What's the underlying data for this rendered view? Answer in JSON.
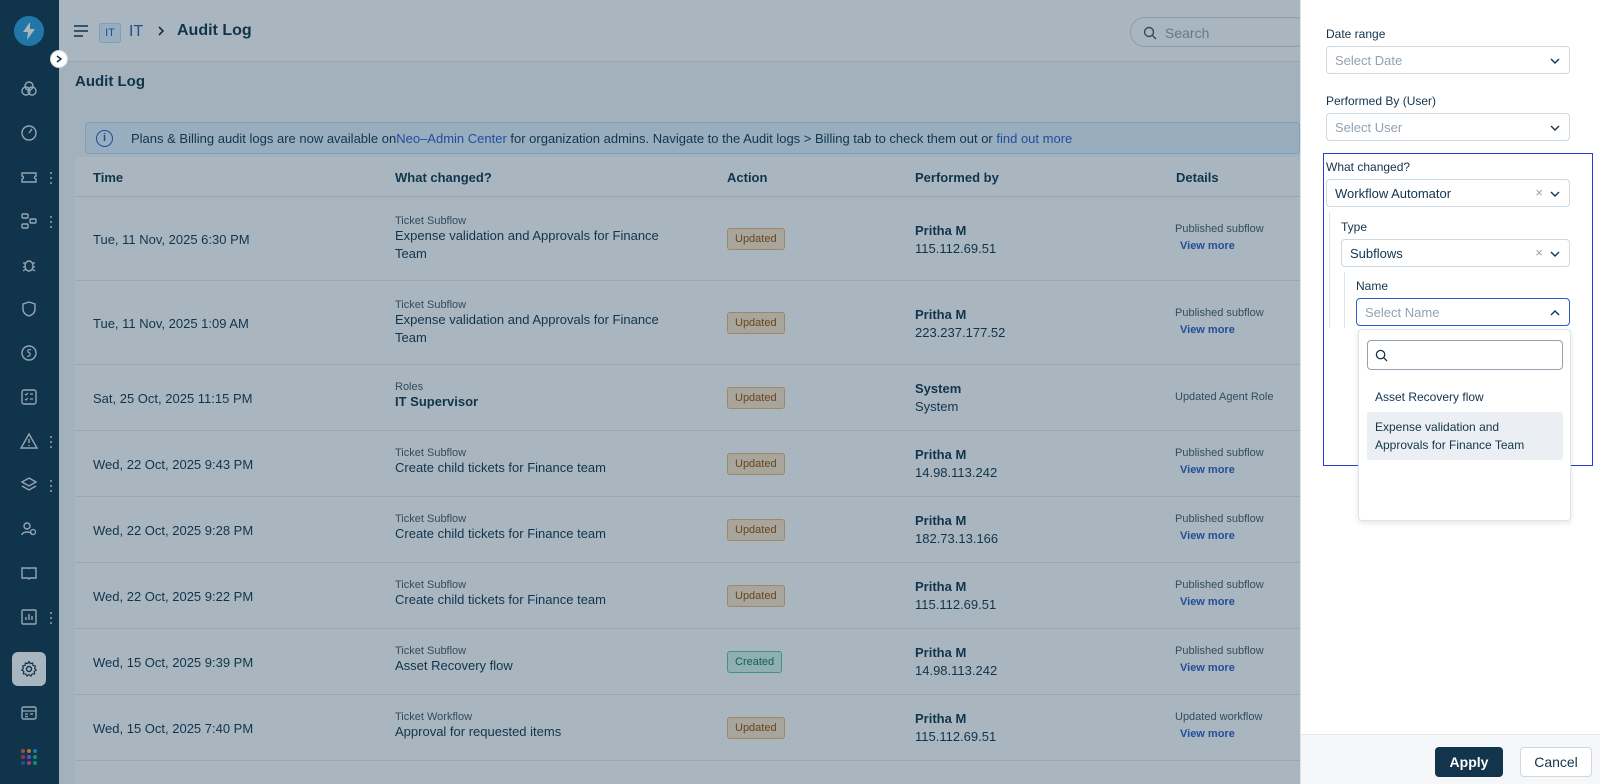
{
  "header": {
    "workspace_badge": "IT",
    "workspace_name": "IT",
    "title": "Audit Log",
    "search_placeholder": "Search"
  },
  "main": {
    "page_title": "Audit Log",
    "banner": {
      "text1": "Plans & Billing audit logs are now available on ",
      "link1": "Neo–Admin Center",
      "text2": " for organization admins. Navigate to the Audit logs > Billing tab to check them out or ",
      "link2": "find out more"
    },
    "columns": [
      "Time",
      "What changed?",
      "Action",
      "Performed by",
      "Details"
    ],
    "rows": [
      {
        "time": "Tue, 11 Nov, 2025 6:30 PM",
        "category": "Ticket Subflow",
        "name": "Expense validation and Approvals for Finance Team",
        "action": "Updated",
        "user": "Pritha M",
        "ip": "115.112.69.51",
        "details": "Published subflow",
        "link": "View more"
      },
      {
        "time": "Tue, 11 Nov, 2025 1:09 AM",
        "category": "Ticket Subflow",
        "name": "Expense validation and Approvals for Finance Team",
        "action": "Updated",
        "user": "Pritha M",
        "ip": "223.237.177.52",
        "details": "Published subflow",
        "link": "View more"
      },
      {
        "time": "Sat, 25 Oct, 2025 11:15 PM",
        "category": "Roles",
        "name": "IT Supervisor",
        "action": "Updated",
        "user": "System",
        "ip": "System",
        "details": "Updated Agent Role",
        "link": ""
      },
      {
        "time": "Wed, 22 Oct, 2025 9:43 PM",
        "category": "Ticket Subflow",
        "name": "Create child tickets for Finance team",
        "action": "Updated",
        "user": "Pritha M",
        "ip": "14.98.113.242",
        "details": "Published subflow",
        "link": "View more"
      },
      {
        "time": "Wed, 22 Oct, 2025 9:28 PM",
        "category": "Ticket Subflow",
        "name": "Create child tickets for Finance team",
        "action": "Updated",
        "user": "Pritha M",
        "ip": "182.73.13.166",
        "details": "Published subflow",
        "link": "View more"
      },
      {
        "time": "Wed, 22 Oct, 2025 9:22 PM",
        "category": "Ticket Subflow",
        "name": "Create child tickets for Finance team",
        "action": "Updated",
        "user": "Pritha M",
        "ip": "115.112.69.51",
        "details": "Published subflow",
        "link": "View more"
      },
      {
        "time": "Wed, 15 Oct, 2025 9:39 PM",
        "category": "Ticket Subflow",
        "name": "Asset Recovery flow",
        "action": "Created",
        "user": "Pritha M",
        "ip": "14.98.113.242",
        "details": "Published subflow",
        "link": "View more"
      },
      {
        "time": "Wed, 15 Oct, 2025 7:40 PM",
        "category": "Ticket Workflow",
        "name": "Approval for requested items",
        "action": "Updated",
        "user": "Pritha M",
        "ip": "115.112.69.51",
        "details": "Updated workflow",
        "link": "View more"
      }
    ]
  },
  "filters": {
    "date_range": {
      "label": "Date range",
      "placeholder": "Select Date"
    },
    "performed_by": {
      "label": "Performed By (User)",
      "placeholder": "Select User"
    },
    "what_changed": {
      "label": "What changed?",
      "value": "Workflow Automator"
    },
    "type": {
      "label": "Type",
      "value": "Subflows"
    },
    "name": {
      "label": "Name",
      "placeholder": "Select Name",
      "search_value": ""
    },
    "options": [
      "Asset Recovery flow",
      "Expense validation and Approvals for Finance Team"
    ],
    "clear_glyph": "×",
    "apply_label": "Apply",
    "cancel_label": "Cancel"
  },
  "colors": {
    "nav_bg": "#12344d",
    "accent": "#2c5cc5",
    "updated_badge": "#fde5c8",
    "created_badge": "#d6f5ea",
    "highlight_border": "#2c3dd5"
  },
  "icons": {
    "nav": [
      "ticket-icon",
      "dashboard-icon",
      "tickets-icon",
      "workflow-icon",
      "bug-icon",
      "shield-icon",
      "dollar-icon",
      "checklist-icon",
      "alert-icon",
      "layers-icon",
      "users-icon",
      "book-icon",
      "chart-icon",
      "gear-icon",
      "calendar-icon",
      "apps-icon"
    ]
  }
}
